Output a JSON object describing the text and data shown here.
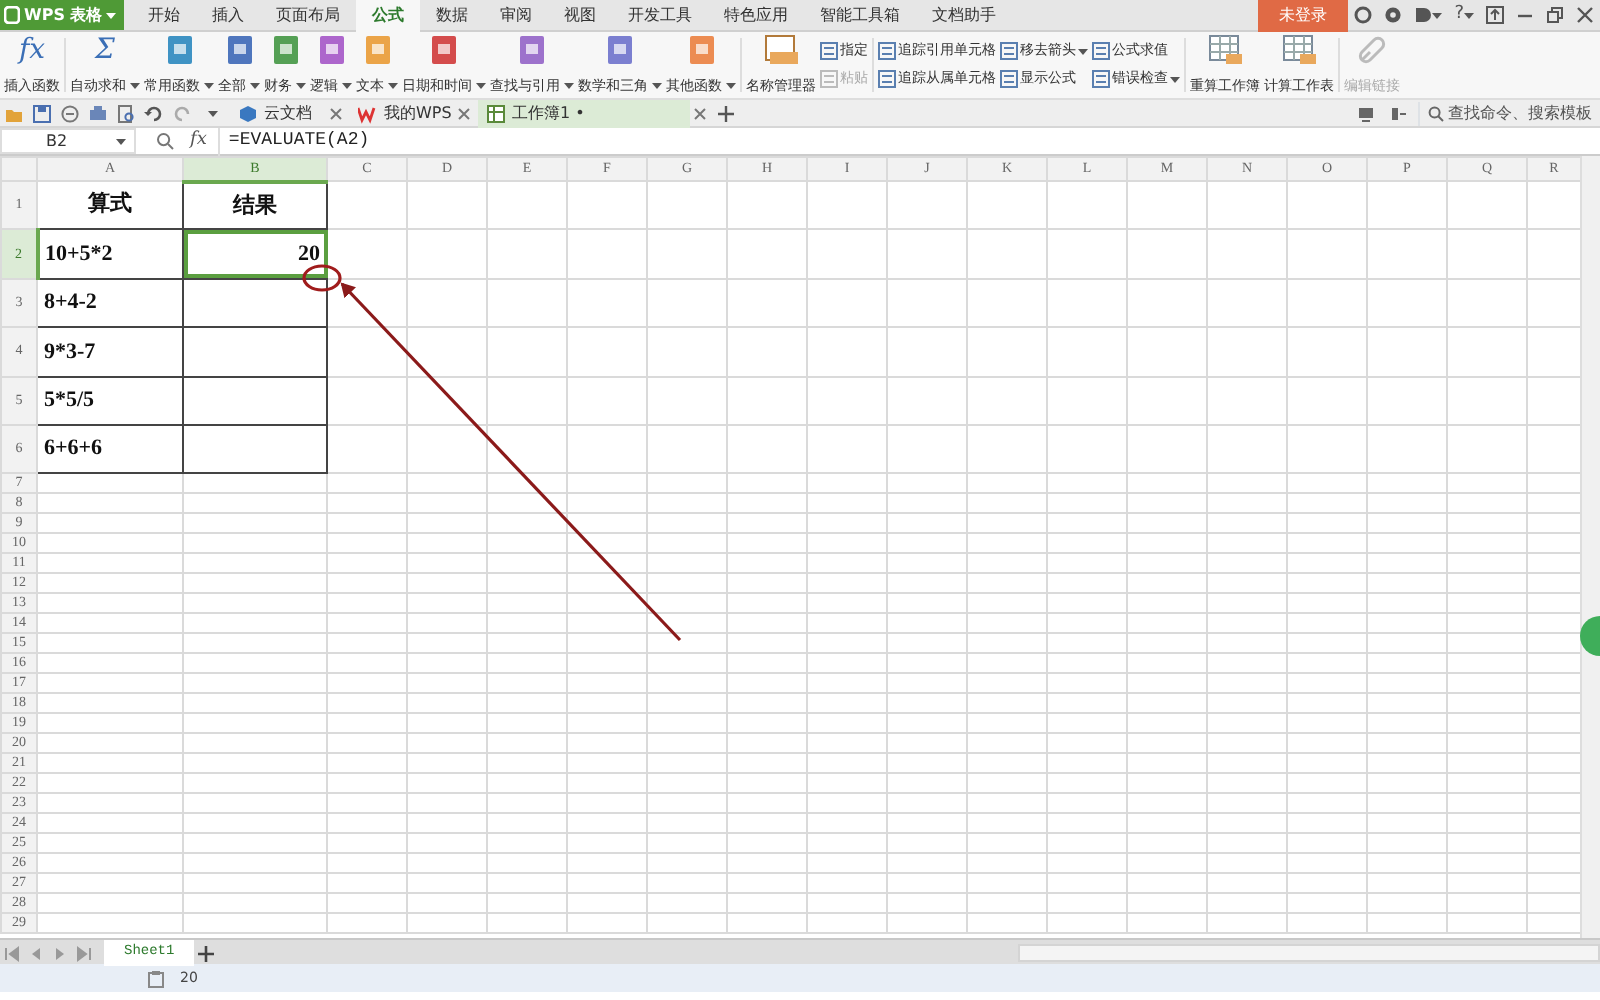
{
  "app": {
    "logo": "WPS 表格"
  },
  "menu_tabs": [
    {
      "label": "开始",
      "selected": false
    },
    {
      "label": "插入",
      "selected": false
    },
    {
      "label": "页面布局",
      "selected": false
    },
    {
      "label": "公式",
      "selected": true
    },
    {
      "label": "数据",
      "selected": false
    },
    {
      "label": "审阅",
      "selected": false
    },
    {
      "label": "视图",
      "selected": false
    },
    {
      "label": "开发工具",
      "selected": false
    },
    {
      "label": "特色应用",
      "selected": false
    },
    {
      "label": "智能工具箱",
      "selected": false
    },
    {
      "label": "文档助手",
      "selected": false
    }
  ],
  "login_button": "未登录",
  "help_label": "?",
  "ribbon": [
    {
      "kind": "glyph",
      "glyph": "fx",
      "label": "插入函数",
      "dropdown": false
    },
    {
      "kind": "separator"
    },
    {
      "kind": "glyph",
      "glyph": "Σ",
      "label": "自动求和",
      "dropdown": true
    },
    {
      "kind": "book",
      "color": "#3f93c4",
      "label": "常用函数",
      "dropdown": true
    },
    {
      "kind": "book",
      "color": "#4f76bd",
      "label": "全部",
      "dropdown": true
    },
    {
      "kind": "book",
      "color": "#55a055",
      "label": "财务",
      "dropdown": true
    },
    {
      "kind": "book",
      "color": "#ad66cc",
      "label": "逻辑",
      "dropdown": true
    },
    {
      "kind": "book",
      "color": "#eba448",
      "label": "文本",
      "dropdown": true
    },
    {
      "kind": "book",
      "color": "#d44c4c",
      "label": "日期和时间",
      "dropdown": true
    },
    {
      "kind": "book",
      "color": "#9d72cc",
      "label": "查找与引用",
      "dropdown": true
    },
    {
      "kind": "book",
      "color": "#7b7fd0",
      "label": "数学和三角",
      "dropdown": true
    },
    {
      "kind": "book",
      "color": "#ec8c52",
      "label": "其他函数",
      "dropdown": true
    },
    {
      "kind": "separator"
    },
    {
      "kind": "names",
      "label": "名称管理器",
      "dropdown": false
    },
    {
      "kind": "stack",
      "items": [
        {
          "label": "指定",
          "dropdown": false,
          "disabled": false
        },
        {
          "label": "粘贴",
          "dropdown": false,
          "disabled": true
        }
      ]
    },
    {
      "kind": "separator"
    },
    {
      "kind": "stack",
      "items": [
        {
          "label": "追踪引用单元格",
          "dropdown": false,
          "disabled": false
        },
        {
          "label": "追踪从属单元格",
          "dropdown": false,
          "disabled": false
        }
      ]
    },
    {
      "kind": "stack",
      "items": [
        {
          "label": "移去箭头",
          "dropdown": true,
          "disabled": false
        },
        {
          "label": "显示公式",
          "dropdown": false,
          "disabled": false
        }
      ]
    },
    {
      "kind": "stack",
      "items": [
        {
          "label": "公式求值",
          "dropdown": false,
          "disabled": false
        },
        {
          "label": "错误检查",
          "dropdown": true,
          "disabled": false
        }
      ]
    },
    {
      "kind": "separator"
    },
    {
      "kind": "recalc",
      "label": "重算工作簿",
      "dropdown": false
    },
    {
      "kind": "recalc",
      "label": "计算工作表",
      "dropdown": false
    },
    {
      "kind": "separator"
    },
    {
      "kind": "link",
      "label": "编辑链接",
      "dropdown": false,
      "disabled": true
    }
  ],
  "doc_tabs": [
    {
      "label": "云文档",
      "selected": false
    },
    {
      "label": "我的WPS",
      "selected": false
    },
    {
      "label": "工作簿1 •",
      "selected": true
    }
  ],
  "search": {
    "placeholder": "查找命令、搜索模板"
  },
  "formula_bar": {
    "name_box": "B2",
    "fx_label": "fx",
    "formula": "=EVALUATE(A2)"
  },
  "sheet": {
    "columns": [
      {
        "label": "A",
        "selected": false
      },
      {
        "label": "B",
        "selected": true
      },
      {
        "label": "C",
        "selected": false
      },
      {
        "label": "D",
        "selected": false
      },
      {
        "label": "E",
        "selected": false
      },
      {
        "label": "F",
        "selected": false
      },
      {
        "label": "G",
        "selected": false
      },
      {
        "label": "H",
        "selected": false
      },
      {
        "label": "I",
        "selected": false
      },
      {
        "label": "J",
        "selected": false
      },
      {
        "label": "K",
        "selected": false
      },
      {
        "label": "L",
        "selected": false
      },
      {
        "label": "M",
        "selected": false
      },
      {
        "label": "N",
        "selected": false
      },
      {
        "label": "O",
        "selected": false
      },
      {
        "label": "P",
        "selected": false
      },
      {
        "label": "Q",
        "selected": false
      },
      {
        "label": "R",
        "selected": false
      }
    ],
    "rows": [
      {
        "header": "1",
        "selected": false,
        "cells": [
          {
            "kind": "heading",
            "text": "算式",
            "selected": false
          },
          {
            "kind": "heading",
            "text": "结果",
            "selected": false
          }
        ]
      },
      {
        "header": "2",
        "selected": true,
        "cells": [
          {
            "kind": "text",
            "text": "10+5*2",
            "selected": false
          },
          {
            "kind": "number",
            "text": "20",
            "selected": true
          }
        ]
      },
      {
        "header": "3",
        "selected": false,
        "cells": [
          {
            "kind": "text",
            "text": "8+4-2",
            "selected": false
          },
          {
            "kind": "number",
            "selected": false
          }
        ]
      },
      {
        "header": "4",
        "selected": false,
        "cells": [
          {
            "kind": "text",
            "text": "9*3-7",
            "selected": false
          },
          {
            "kind": "number",
            "selected": false
          }
        ]
      },
      {
        "header": "5",
        "selected": false,
        "cells": [
          {
            "kind": "text",
            "text": "5*5/5",
            "selected": false
          },
          {
            "kind": "number",
            "selected": false
          }
        ]
      },
      {
        "header": "6",
        "selected": false,
        "cells": [
          {
            "kind": "text",
            "text": "6+6+6",
            "selected": false
          },
          {
            "kind": "number",
            "selected": false
          }
        ]
      },
      {
        "header": "7"
      },
      {
        "header": "8"
      },
      {
        "header": "9"
      },
      {
        "header": "10"
      },
      {
        "header": "11"
      },
      {
        "header": "12"
      },
      {
        "header": "13"
      },
      {
        "header": "14"
      },
      {
        "header": "15"
      },
      {
        "header": "16"
      },
      {
        "header": "17"
      },
      {
        "header": "18"
      },
      {
        "header": "19"
      },
      {
        "header": "20"
      },
      {
        "header": "21"
      },
      {
        "header": "22"
      },
      {
        "header": "23"
      },
      {
        "header": "24"
      },
      {
        "header": "25"
      },
      {
        "header": "26"
      },
      {
        "header": "27"
      },
      {
        "header": "28"
      },
      {
        "header": "29"
      }
    ]
  },
  "sheet_tabs": [
    {
      "label": "Sheet1",
      "selected": true
    }
  ],
  "status_bar": {
    "value": "20"
  }
}
